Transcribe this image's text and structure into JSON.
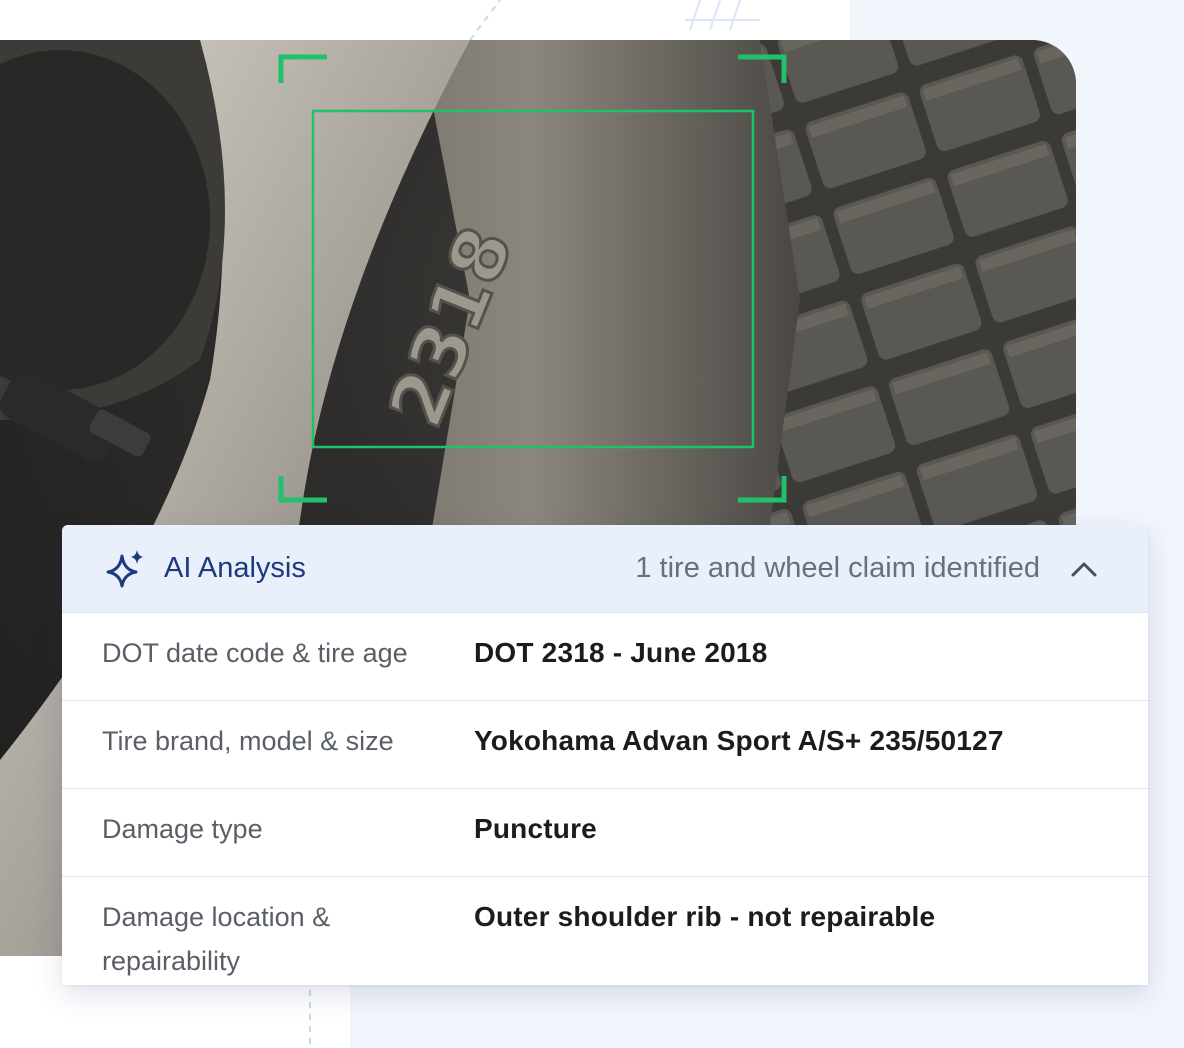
{
  "analysis": {
    "title": "AI Analysis",
    "summary": "1 tire and wheel claim identified",
    "collapse_icon": "chevron-up-icon",
    "header_icon": "sparkle-icon",
    "accent_color": "#1b3a80",
    "frame_color": "#22c06a",
    "rows": [
      {
        "label": "DOT date code & tire age",
        "value": "DOT 2318 - June 2018"
      },
      {
        "label": "Tire brand, model & size",
        "value": "Yokohama Advan Sport A/S+ 235/50127"
      },
      {
        "label": "Damage type",
        "value": "Puncture"
      },
      {
        "label": "Damage location & repairability",
        "value": "Outer shoulder rib - not repairable"
      }
    ]
  },
  "photo": {
    "sidewall_code": "2318"
  }
}
